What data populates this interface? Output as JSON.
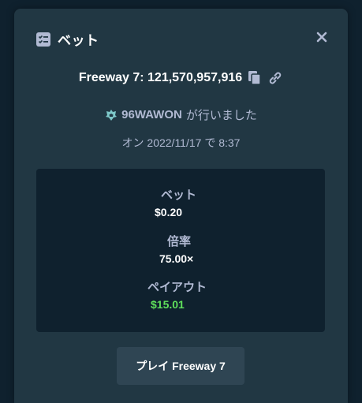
{
  "modal": {
    "title": "ベット",
    "close_icon": "close-icon"
  },
  "game": {
    "title": "Freeway 7: 121,570,957,916",
    "copy_icon": "copy-icon",
    "link_icon": "link-icon"
  },
  "player": {
    "name": "96WAWON",
    "suffix": "が行いました",
    "rank_icon": "crown-icon"
  },
  "date": "オン 2022/11/17 で 8:37",
  "stats": {
    "bet_label": "ベット",
    "bet_value": "$0.20",
    "multiplier_label": "倍率",
    "multiplier_value": "75.00×",
    "payout_label": "ペイアウト",
    "payout_value": "$15.01"
  },
  "play_button": "プレイ Freeway 7",
  "colors": {
    "background": "#0f212e",
    "modal": "#213743",
    "payout_green": "#5fe05b",
    "text_muted": "#b1bad3"
  }
}
